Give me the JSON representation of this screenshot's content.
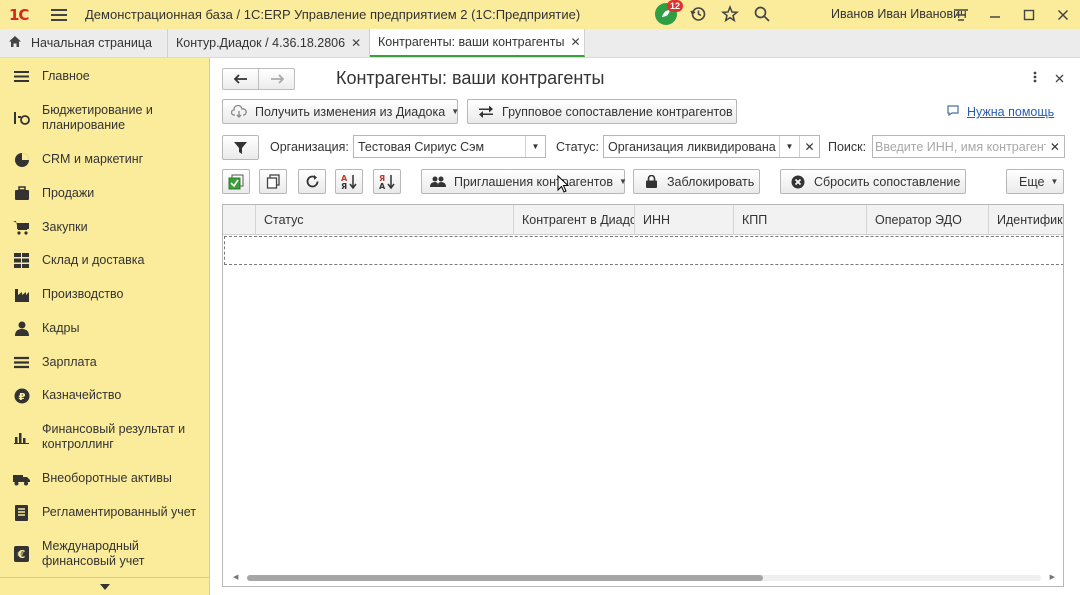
{
  "titlebar": {
    "logo": "1С",
    "title": "Демонстрационная база / 1С:ERP Управление предприятием 2  (1С:Предприятие)",
    "notifications_count": "12",
    "user": "Иванов Иван Иванович"
  },
  "tabs": [
    {
      "label": "Начальная страница"
    },
    {
      "label": "Контур.Диадок / 4.36.18.2806"
    },
    {
      "label": "Контрагенты: ваши контрагенты"
    }
  ],
  "sidebar": {
    "items": [
      {
        "label": "Главное",
        "icon": "menu-lines-icon"
      },
      {
        "label": "Бюджетирование и планирование",
        "icon": "budget-icon"
      },
      {
        "label": "CRM и маркетинг",
        "icon": "pie-chart-icon"
      },
      {
        "label": "Продажи",
        "icon": "briefcase-icon"
      },
      {
        "label": "Закупки",
        "icon": "cart-icon"
      },
      {
        "label": "Склад и доставка",
        "icon": "grid-icon"
      },
      {
        "label": "Производство",
        "icon": "factory-icon"
      },
      {
        "label": "Кадры",
        "icon": "person-icon"
      },
      {
        "label": "Зарплата",
        "icon": "list-icon"
      },
      {
        "label": "Казначейство",
        "icon": "ruble-icon"
      },
      {
        "label": "Финансовый результат и контроллинг",
        "icon": "bar-chart-icon"
      },
      {
        "label": "Внеоборотные активы",
        "icon": "truck-icon"
      },
      {
        "label": "Регламентированный учет",
        "icon": "document-icon"
      },
      {
        "label": "Международный финансовый учет",
        "icon": "currency-icon"
      }
    ]
  },
  "main": {
    "title": "Контрагенты: ваши контрагенты",
    "get_changes_button": "Получить изменения из Диадока",
    "group_match_button": "Групповое сопоставление контрагентов",
    "help_link": "Нужна помощь",
    "filter": {
      "org_label": "Организация:",
      "org_value": "Тестовая Сириус Сэм",
      "status_label": "Статус:",
      "status_value": "Организация ликвидирована",
      "search_label": "Поиск:",
      "search_placeholder": "Введите ИНН, имя контрагента"
    },
    "toolbar": {
      "invitations_button": "Приглашения контрагентов",
      "block_button": "Заблокировать",
      "reset_match_button": "Сбросить сопоставление",
      "more_button": "Еще"
    },
    "table": {
      "columns": [
        "Статус",
        "Контрагент в Диадоке",
        "ИНН",
        "КПП",
        "Оператор ЭДО",
        "Идентификатор"
      ]
    }
  }
}
